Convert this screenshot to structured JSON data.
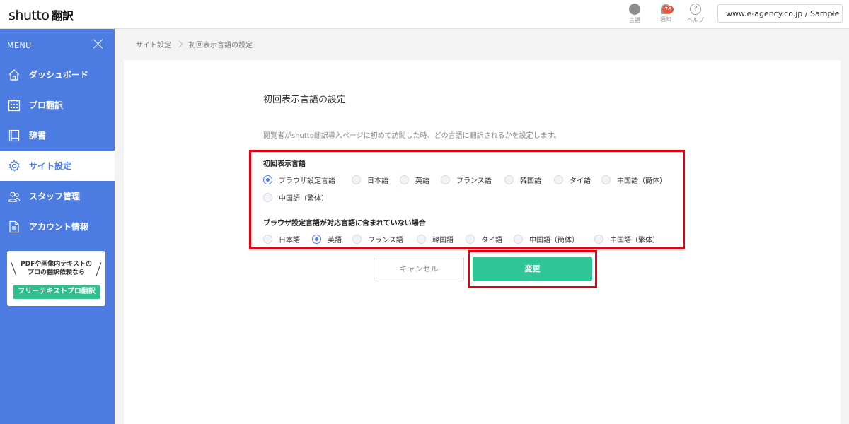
{
  "header": {
    "logo_text": "shutto",
    "logo_suffix": "翻訳",
    "icons": [
      {
        "name": "globe-icon",
        "label": "言語"
      },
      {
        "name": "bell-icon",
        "label": "通知",
        "badge": "76"
      },
      {
        "name": "help-icon",
        "label": "ヘルプ",
        "glyph": "?"
      }
    ],
    "site_selector": "www.e-agency.co.jp / Sample"
  },
  "sidebar": {
    "menu_label": "MENU",
    "items": [
      {
        "label": "ダッシュボード",
        "icon": "home-icon",
        "active": false
      },
      {
        "label": "プロ翻訳",
        "icon": "calendar-icon",
        "active": false
      },
      {
        "label": "辞書",
        "icon": "book-icon",
        "active": false
      },
      {
        "label": "サイト設定",
        "icon": "gear-icon",
        "active": true
      },
      {
        "label": "スタッフ管理",
        "icon": "staff-icon",
        "active": false
      },
      {
        "label": "アカウント情報",
        "icon": "document-icon",
        "active": false
      }
    ],
    "promo": {
      "line1": "PDFや画像内テキストの",
      "line2": "プロの翻訳依頼なら",
      "button": "フリーテキストプロ翻訳"
    }
  },
  "breadcrumb": [
    "サイト設定",
    "初回表示言語の設定"
  ],
  "main": {
    "title": "初回表示言語の設定",
    "description": "閲覧者がshutto翻訳導入ページに初めて訪問した時、どの言語に翻訳されるかを設定します。",
    "initial_language": {
      "label": "初回表示言語",
      "options": [
        "ブラウザ設定言語",
        "日本語",
        "英語",
        "フランス語",
        "韓国語",
        "タイ語",
        "中国語（簡体）",
        "中国語（繁体）"
      ],
      "selected": "ブラウザ設定言語"
    },
    "fallback_language": {
      "label": "ブラウザ設定言語が対応言語に含まれていない場合",
      "options": [
        "日本語",
        "英語",
        "フランス語",
        "韓国語",
        "タイ語",
        "中国語（簡体）",
        "中国語（繁体）"
      ],
      "selected": "英語"
    },
    "cancel_label": "キャンセル",
    "save_label": "変更"
  },
  "colors": {
    "sidebar": "#4c7be2",
    "primary_button": "#2fc695",
    "highlight": "#e3000f"
  }
}
